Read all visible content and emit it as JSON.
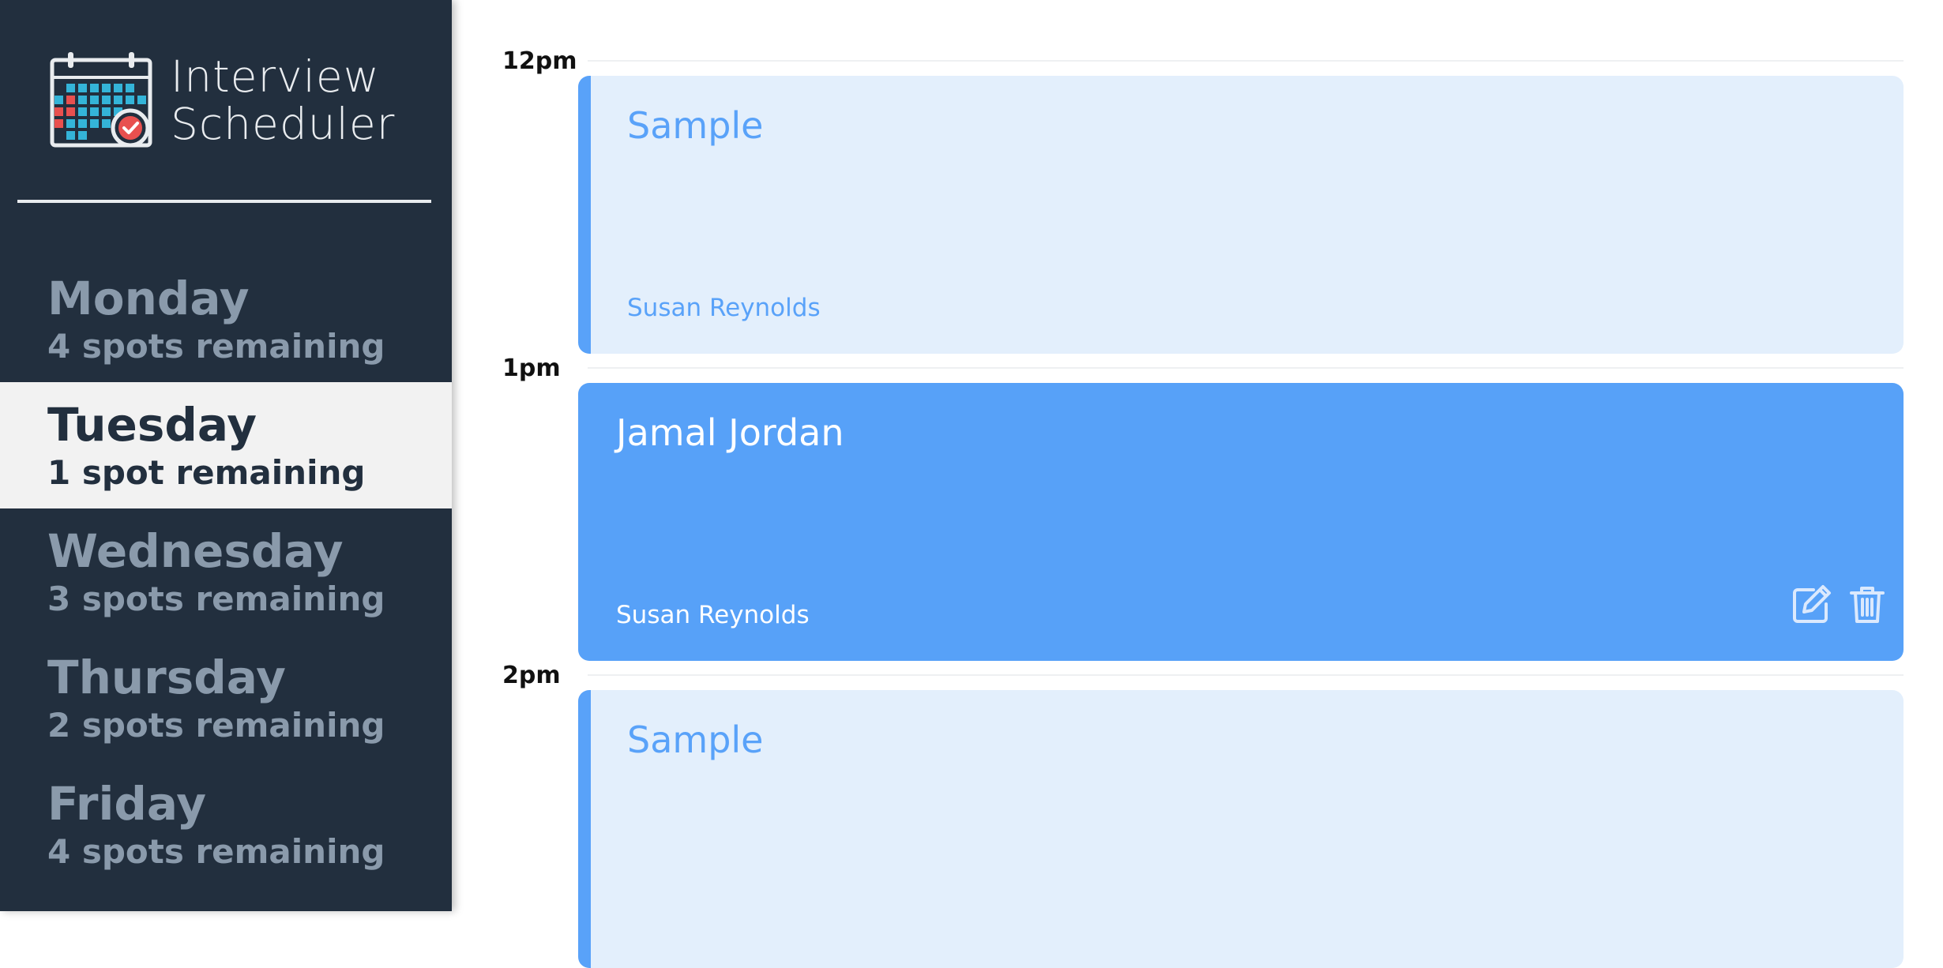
{
  "brand": {
    "line1": "Interview",
    "line2": "Scheduler",
    "logo_icon": "calendar-check-icon"
  },
  "days": [
    {
      "name": "Monday",
      "spots": "4 spots remaining",
      "selected": false
    },
    {
      "name": "Tuesday",
      "spots": "1 spot remaining",
      "selected": true
    },
    {
      "name": "Wednesday",
      "spots": "3 spots remaining",
      "selected": false
    },
    {
      "name": "Thursday",
      "spots": "2 spots remaining",
      "selected": false
    },
    {
      "name": "Friday",
      "spots": "4 spots remaining",
      "selected": false
    }
  ],
  "schedule": {
    "slots": [
      {
        "time": "12pm",
        "title": "Sample",
        "interviewer": "Susan Reynolds",
        "booked": false
      },
      {
        "time": "1pm",
        "title": "Jamal Jordan",
        "interviewer": "Susan Reynolds",
        "booked": true,
        "actions": [
          "edit-icon",
          "trash-icon"
        ]
      },
      {
        "time": "2pm",
        "title": "Sample",
        "interviewer": "",
        "booked": false
      }
    ]
  },
  "colors": {
    "sidebar_bg": "#222f3e",
    "selected_bg": "#f2f2f2",
    "accent_blue": "#57a1f8",
    "empty_slot_bg": "#e3effc",
    "muted_text": "#8a9aab"
  }
}
